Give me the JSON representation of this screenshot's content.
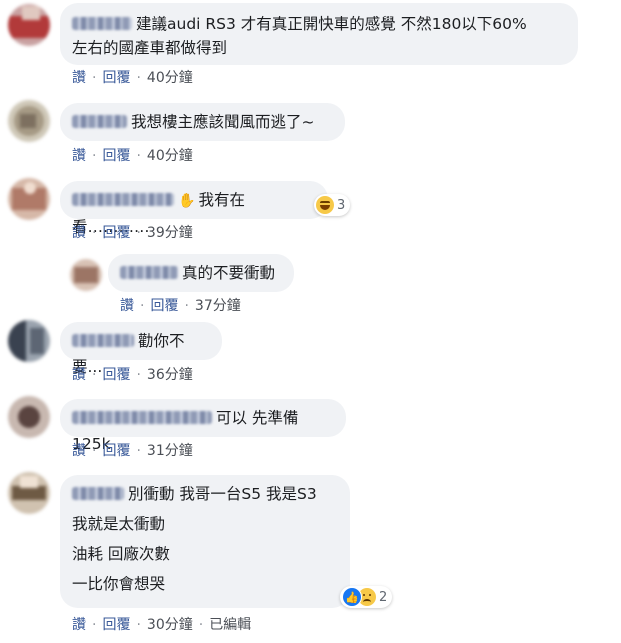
{
  "comments": [
    {
      "lines": [
        "建議audi RS3 才有真正開快車的感覺 不然180以下60%",
        "左右的國產車都做得到"
      ],
      "actions": {
        "like": "讚",
        "reply": "回覆",
        "time": "40分鐘"
      }
    },
    {
      "lines": [
        "我想樓主應該聞風而逃了~"
      ],
      "actions": {
        "like": "讚",
        "reply": "回覆",
        "time": "40分鐘"
      }
    },
    {
      "lines": [
        "我有在看…………"
      ],
      "actions": {
        "like": "讚",
        "reply": "回覆",
        "time": "39分鐘"
      },
      "reaction": {
        "icon": "haha-emoji",
        "count": "3"
      }
    },
    {
      "lines": [
        "真的不要衝動"
      ],
      "actions": {
        "like": "讚",
        "reply": "回覆",
        "time": "37分鐘"
      }
    },
    {
      "lines": [
        "勸你不要..."
      ],
      "actions": {
        "like": "讚",
        "reply": "回覆",
        "time": "36分鐘"
      }
    },
    {
      "lines": [
        "可以 先準備125k"
      ],
      "actions": {
        "like": "讚",
        "reply": "回覆",
        "time": "31分鐘"
      }
    },
    {
      "lines": [
        "別衝動 我哥一台S5 我是S3",
        "我就是太衝動",
        "油耗 回廠次數",
        "一比你會想哭"
      ],
      "actions": {
        "like": "讚",
        "reply": "回覆",
        "time": "30分鐘",
        "edited": "已編輯"
      },
      "reaction": {
        "icon": "like-and-sad",
        "count": "2"
      }
    }
  ],
  "colors": {
    "bubble": "#f0f2f5",
    "link": "#385898",
    "text": "#1c1e21"
  }
}
